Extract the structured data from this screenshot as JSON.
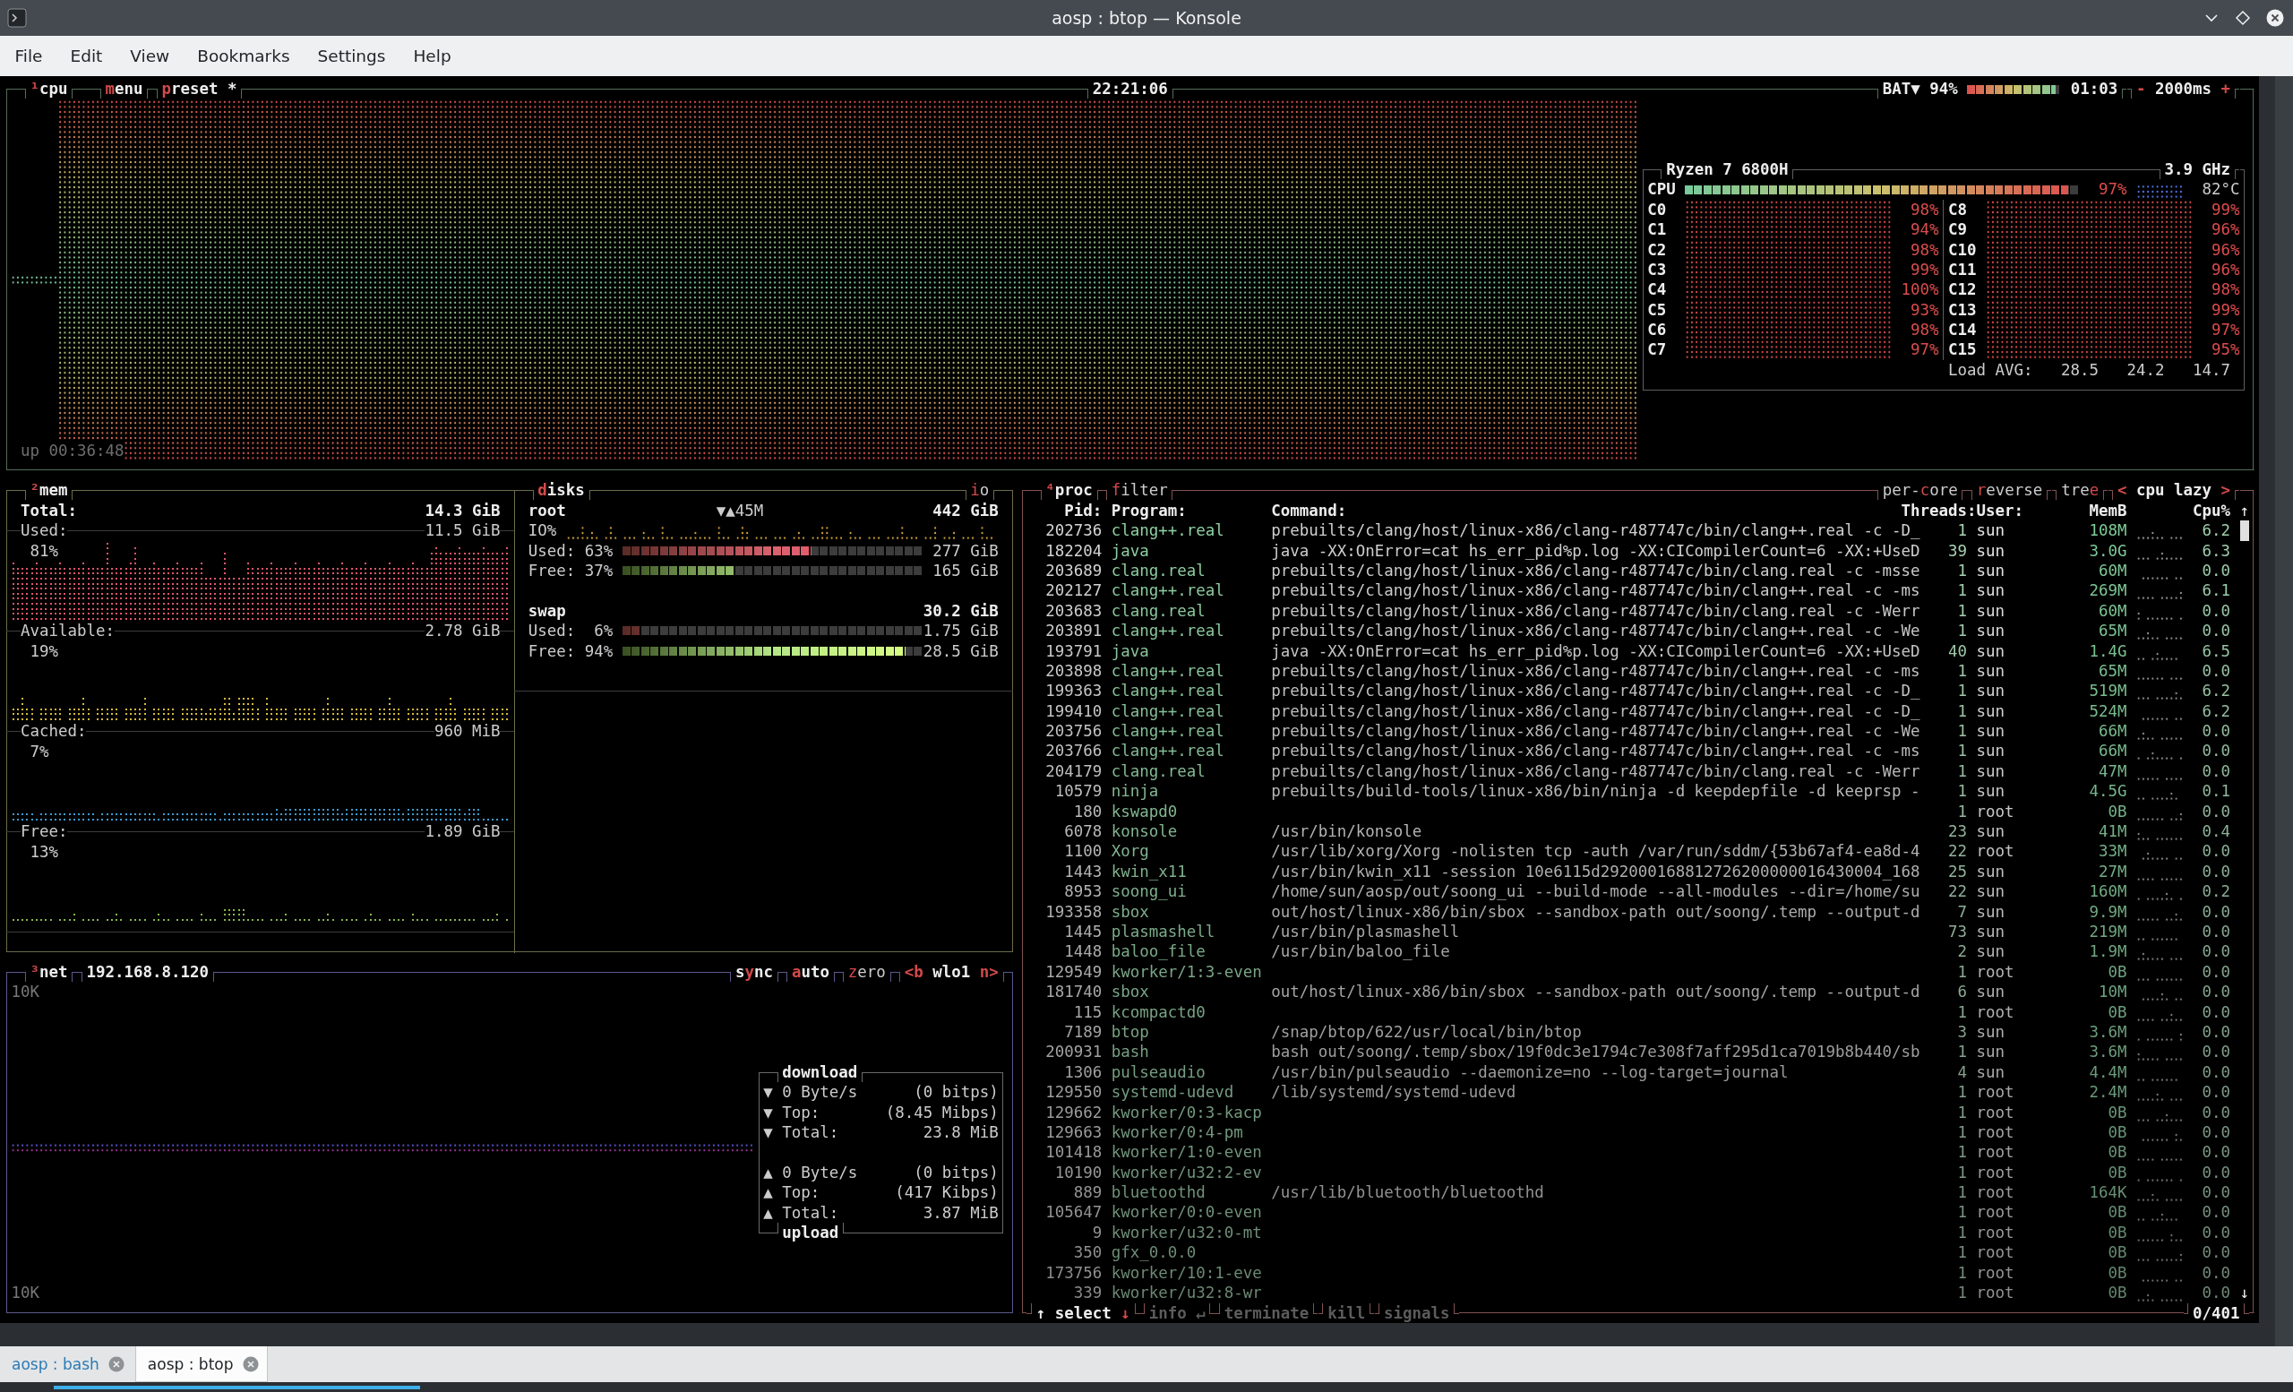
{
  "window": {
    "title": "aosp : btop — Konsole"
  },
  "menu": [
    "File",
    "Edit",
    "View",
    "Bookmarks",
    "Settings",
    "Help"
  ],
  "cpu": {
    "header": {
      "title": {
        "parts": [
          {
            "kind": "number",
            "text": "¹"
          },
          {
            "kind": "label",
            "text": "cpu"
          }
        ]
      },
      "left": [
        {
          "on": true,
          "parts": [
            {
              "kind": "key",
              "text": "m"
            },
            {
              "kind": "label",
              "text": "enu"
            }
          ]
        },
        {
          "on": true,
          "parts": [
            {
              "kind": "key",
              "text": "p"
            },
            {
              "kind": "label",
              "text": "reset *"
            }
          ]
        }
      ],
      "clock": "22:21:06",
      "battery": {
        "label": "BAT▼ 94%",
        "level": 0.94,
        "time": "01:03"
      },
      "right": [
        {
          "on": true,
          "parts": [
            {
              "kind": "key",
              "text": "-"
            },
            {
              "kind": "label",
              "text": " 2000ms "
            },
            {
              "kind": "key",
              "text": "+"
            }
          ]
        }
      ]
    },
    "uptime": "up 00:36:48",
    "info": {
      "model": "Ryzen 7 6800H",
      "frequency": "3.9 GHz",
      "total": {
        "label": "CPU",
        "level": 0.97,
        "percent": "97%",
        "temperature": "82°C"
      },
      "cores": [
        {
          "label": "C0",
          "percent": "98%"
        },
        {
          "label": "C1",
          "percent": "94%"
        },
        {
          "label": "C2",
          "percent": "98%"
        },
        {
          "label": "C3",
          "percent": "99%"
        },
        {
          "label": "C4",
          "percent": "100%"
        },
        {
          "label": "C5",
          "percent": "93%"
        },
        {
          "label": "C6",
          "percent": "98%"
        },
        {
          "label": "C7",
          "percent": "97%"
        },
        {
          "label": "C8",
          "percent": "99%"
        },
        {
          "label": "C9",
          "percent": "96%"
        },
        {
          "label": "C10",
          "percent": "96%"
        },
        {
          "label": "C11",
          "percent": "96%"
        },
        {
          "label": "C12",
          "percent": "98%"
        },
        {
          "label": "C13",
          "percent": "99%"
        },
        {
          "label": "C14",
          "percent": "97%"
        },
        {
          "label": "C15",
          "percent": "95%"
        }
      ],
      "load": {
        "label": "Load AVG:",
        "values": [
          "28.5",
          "24.2",
          "14.7"
        ]
      }
    }
  },
  "mem": {
    "header": {
      "title": {
        "parts": [
          {
            "kind": "number",
            "text": "²"
          },
          {
            "kind": "label",
            "text": "mem"
          }
        ]
      }
    },
    "total": {
      "label": "Total:",
      "value": "14.3 GiB"
    },
    "sections": [
      {
        "label": "Used:",
        "value": "11.5 GiB",
        "percent": "81%",
        "color": "#e0566b"
      },
      {
        "label": "Available:",
        "value": "2.78 GiB",
        "percent": "19%",
        "color": "#d6b83e"
      },
      {
        "label": "Cached:",
        "value": "960 MiB",
        "percent": "7%",
        "color": "#3f9bd0"
      },
      {
        "label": "Free:",
        "value": "1.89 GiB",
        "percent": "13%",
        "color": "#87b54c"
      }
    ]
  },
  "disks": {
    "header": {
      "title": {
        "parts": [
          {
            "kind": "key",
            "text": "d"
          },
          {
            "kind": "label",
            "text": "isks"
          }
        ]
      },
      "right": [
        {
          "on": false,
          "parts": [
            {
              "kind": "key",
              "text": "i"
            },
            {
              "kind": "label",
              "text": "o"
            }
          ]
        }
      ]
    },
    "items": [
      {
        "name": "root",
        "io": "▼▲45M",
        "total": "442 GiB",
        "io_label": "IO%",
        "bars": [
          {
            "kind": "used",
            "label": "Used:",
            "percent": "63%",
            "level": 0.63,
            "value": "277 GiB"
          },
          {
            "kind": "free",
            "label": "Free:",
            "percent": "37%",
            "level": 0.37,
            "value": "165 GiB"
          }
        ]
      },
      {
        "name": "swap",
        "total": "30.2 GiB",
        "bars": [
          {
            "kind": "used",
            "label": "Used:",
            "percent": "6%",
            "level": 0.06,
            "value": "1.75 GiB"
          },
          {
            "kind": "free",
            "label": "Free:",
            "percent": "94%",
            "level": 0.94,
            "value": "28.5 GiB"
          }
        ]
      }
    ]
  },
  "net": {
    "header": {
      "title": {
        "parts": [
          {
            "kind": "number",
            "text": "³"
          },
          {
            "kind": "label",
            "text": "net"
          }
        ]
      },
      "address": "192.168.8.120",
      "right": [
        {
          "on": true,
          "parts": [
            {
              "kind": "label",
              "text": "s"
            },
            {
              "kind": "key",
              "text": "y"
            },
            {
              "kind": "label",
              "text": "nc"
            }
          ]
        },
        {
          "on": true,
          "parts": [
            {
              "kind": "key",
              "text": "a"
            },
            {
              "kind": "label",
              "text": "uto"
            }
          ]
        },
        {
          "on": false,
          "parts": [
            {
              "kind": "key",
              "text": "z"
            },
            {
              "kind": "label",
              "text": "ero"
            }
          ]
        },
        {
          "on": true,
          "parts": [
            {
              "kind": "key",
              "text": "<b"
            },
            {
              "kind": "label",
              "text": " wlo1 "
            },
            {
              "kind": "key",
              "text": "n>"
            }
          ]
        }
      ]
    },
    "scale_top": "10K",
    "scale_bottom": "10K",
    "download": {
      "title": "download",
      "rows": [
        {
          "arrow": "▼",
          "label": "0 Byte/s",
          "value": "(0 bitps)"
        },
        {
          "arrow": "▼",
          "label": "Top:",
          "value": "(8.45 Mibps)"
        },
        {
          "arrow": "▼",
          "label": "Total:",
          "value": "23.8 MiB"
        }
      ]
    },
    "upload": {
      "title": "upload",
      "rows": [
        {
          "arrow": "▲",
          "label": "0 Byte/s",
          "value": "(0 bitps)"
        },
        {
          "arrow": "▲",
          "label": "Top:",
          "value": "(417 Kibps)"
        },
        {
          "arrow": "▲",
          "label": "Total:",
          "value": "3.87 MiB"
        }
      ]
    }
  },
  "proc": {
    "header": {
      "title": {
        "parts": [
          {
            "kind": "number",
            "text": "⁴"
          },
          {
            "kind": "label",
            "text": "proc"
          }
        ]
      },
      "left": [
        {
          "on": false,
          "parts": [
            {
              "kind": "key",
              "text": "f"
            },
            {
              "kind": "label",
              "text": "ilter"
            }
          ]
        }
      ],
      "right": [
        {
          "on": false,
          "parts": [
            {
              "kind": "label",
              "text": "per-"
            },
            {
              "kind": "key",
              "text": "c"
            },
            {
              "kind": "label",
              "text": "ore"
            }
          ]
        },
        {
          "on": false,
          "parts": [
            {
              "kind": "key",
              "text": "r"
            },
            {
              "kind": "label",
              "text": "everse"
            }
          ]
        },
        {
          "on": false,
          "parts": [
            {
              "kind": "label",
              "text": "tre"
            },
            {
              "kind": "key",
              "text": "e"
            }
          ]
        },
        {
          "on": true,
          "parts": [
            {
              "kind": "key",
              "text": "<"
            },
            {
              "kind": "label",
              "text": " cpu lazy "
            },
            {
              "kind": "key",
              "text": ">"
            }
          ]
        }
      ]
    },
    "columns": {
      "pid": "Pid:",
      "program": "Program:",
      "command": "Command:",
      "threads": "Threads:",
      "user": "User:",
      "mem": "MemB",
      "cpu": "Cpu%"
    },
    "scroll_up": "↑",
    "scroll_down": "↓",
    "rows": [
      {
        "pid": "202736",
        "program": "clang++.real",
        "command": "prebuilts/clang/host/linux-x86/clang-r487747c/bin/clang++.real -c -D_",
        "threads": "1",
        "user": "sun",
        "mem": "108M",
        "cpu": "6.2",
        "selected": false
      },
      {
        "pid": "182204",
        "program": "java",
        "command": "java -XX:OnError=cat hs_err_pid%p.log -XX:CICompilerCount=6 -XX:+UseD",
        "threads": "39",
        "user": "sun",
        "mem": "3.0G",
        "cpu": "6.3",
        "selected": false
      },
      {
        "pid": "203689",
        "program": "clang.real",
        "command": "prebuilts/clang/host/linux-x86/clang-r487747c/bin/clang.real -c -msse",
        "threads": "1",
        "user": "sun",
        "mem": "60M",
        "cpu": "0.0",
        "selected": false
      },
      {
        "pid": "202127",
        "program": "clang++.real",
        "command": "prebuilts/clang/host/linux-x86/clang-r487747c/bin/clang++.real -c -ms",
        "threads": "1",
        "user": "sun",
        "mem": "269M",
        "cpu": "6.1",
        "selected": false
      },
      {
        "pid": "203683",
        "program": "clang.real",
        "command": "prebuilts/clang/host/linux-x86/clang-r487747c/bin/clang.real -c -Werr",
        "threads": "1",
        "user": "sun",
        "mem": "60M",
        "cpu": "0.0",
        "selected": false
      },
      {
        "pid": "203891",
        "program": "clang++.real",
        "command": "prebuilts/clang/host/linux-x86/clang-r487747c/bin/clang++.real -c -We",
        "threads": "1",
        "user": "sun",
        "mem": "65M",
        "cpu": "0.0",
        "selected": false
      },
      {
        "pid": "193791",
        "program": "java",
        "command": "java -XX:OnError=cat hs_err_pid%p.log -XX:CICompilerCount=6 -XX:+UseD",
        "threads": "40",
        "user": "sun",
        "mem": "1.4G",
        "cpu": "6.5",
        "selected": false
      },
      {
        "pid": "203898",
        "program": "clang++.real",
        "command": "prebuilts/clang/host/linux-x86/clang-r487747c/bin/clang++.real -c -ms",
        "threads": "1",
        "user": "sun",
        "mem": "65M",
        "cpu": "0.0",
        "selected": false
      },
      {
        "pid": "199363",
        "program": "clang++.real",
        "command": "prebuilts/clang/host/linux-x86/clang-r487747c/bin/clang++.real -c -D_",
        "threads": "1",
        "user": "sun",
        "mem": "519M",
        "cpu": "6.2",
        "selected": false
      },
      {
        "pid": "199410",
        "program": "clang++.real",
        "command": "prebuilts/clang/host/linux-x86/clang-r487747c/bin/clang++.real -c -D_",
        "threads": "1",
        "user": "sun",
        "mem": "524M",
        "cpu": "6.2",
        "selected": false
      },
      {
        "pid": "203756",
        "program": "clang++.real",
        "command": "prebuilts/clang/host/linux-x86/clang-r487747c/bin/clang++.real -c -We",
        "threads": "1",
        "user": "sun",
        "mem": "66M",
        "cpu": "0.0",
        "selected": false
      },
      {
        "pid": "203766",
        "program": "clang++.real",
        "command": "prebuilts/clang/host/linux-x86/clang-r487747c/bin/clang++.real -c -ms",
        "threads": "1",
        "user": "sun",
        "mem": "66M",
        "cpu": "0.0",
        "selected": false
      },
      {
        "pid": "204179",
        "program": "clang.real",
        "command": "prebuilts/clang/host/linux-x86/clang-r487747c/bin/clang.real -c -Werr",
        "threads": "1",
        "user": "sun",
        "mem": "47M",
        "cpu": "0.0",
        "selected": false
      },
      {
        "pid": "10579",
        "program": "ninja",
        "command": "prebuilts/build-tools/linux-x86/bin/ninja -d keepdepfile -d keeprsp -",
        "threads": "1",
        "user": "sun",
        "mem": "4.5G",
        "cpu": "0.1",
        "selected": false
      },
      {
        "pid": "180",
        "program": "kswapd0",
        "threads": "1",
        "user": "root",
        "mem": "0B",
        "cpu": "0.0",
        "selected": false
      },
      {
        "pid": "6078",
        "program": "konsole",
        "command": "/usr/bin/konsole",
        "threads": "23",
        "user": "sun",
        "mem": "41M",
        "cpu": "0.4",
        "selected": false
      },
      {
        "pid": "1100",
        "program": "Xorg",
        "command": "/usr/lib/xorg/Xorg -nolisten tcp -auth /var/run/sddm/{53b67af4-ea8d-4",
        "threads": "22",
        "user": "root",
        "mem": "33M",
        "cpu": "0.0",
        "selected": false
      },
      {
        "pid": "1443",
        "program": "kwin_x11",
        "command": "/usr/bin/kwin_x11 -session 10e6115d292000168812726200000016430004_168",
        "threads": "25",
        "user": "sun",
        "mem": "27M",
        "cpu": "0.0",
        "selected": false
      },
      {
        "pid": "8953",
        "program": "soong_ui",
        "command": "/home/sun/aosp/out/soong_ui --build-mode --all-modules --dir=/home/su",
        "threads": "22",
        "user": "sun",
        "mem": "160M",
        "cpu": "0.2",
        "selected": false
      },
      {
        "pid": "193358",
        "program": "sbox",
        "command": "out/host/linux-x86/bin/sbox --sandbox-path out/soong/.temp --output-d",
        "threads": "7",
        "user": "sun",
        "mem": "9.9M",
        "cpu": "0.0",
        "selected": false
      },
      {
        "pid": "1445",
        "program": "plasmashell",
        "command": "/usr/bin/plasmashell",
        "threads": "73",
        "user": "sun",
        "mem": "219M",
        "cpu": "0.0",
        "selected": false
      },
      {
        "pid": "1448",
        "program": "baloo_file",
        "command": "/usr/bin/baloo_file",
        "threads": "2",
        "user": "sun",
        "mem": "1.9M",
        "cpu": "0.0",
        "selected": false
      },
      {
        "pid": "129549",
        "program": "kworker/1:3-even",
        "threads": "1",
        "user": "root",
        "mem": "0B",
        "cpu": "0.0",
        "selected": false
      },
      {
        "pid": "181740",
        "program": "sbox",
        "command": "out/host/linux-x86/bin/sbox --sandbox-path out/soong/.temp --output-d",
        "threads": "6",
        "user": "sun",
        "mem": "10M",
        "cpu": "0.0",
        "selected": false
      },
      {
        "pid": "115",
        "program": "kcompactd0",
        "threads": "1",
        "user": "root",
        "mem": "0B",
        "cpu": "0.0",
        "selected": false
      },
      {
        "pid": "7189",
        "program": "btop",
        "command": "/snap/btop/622/usr/local/bin/btop",
        "threads": "3",
        "user": "sun",
        "mem": "3.6M",
        "cpu": "0.0",
        "selected": false
      },
      {
        "pid": "200931",
        "program": "bash",
        "command": "bash out/soong/.temp/sbox/19f0dc3e1794c7e308f7aff295d1ca7019b8b440/sb",
        "threads": "1",
        "user": "sun",
        "mem": "3.6M",
        "cpu": "0.0",
        "selected": false
      },
      {
        "pid": "1306",
        "program": "pulseaudio",
        "command": "/usr/bin/pulseaudio --daemonize=no --log-target=journal",
        "threads": "4",
        "user": "sun",
        "mem": "4.4M",
        "cpu": "0.0",
        "selected": false
      },
      {
        "pid": "129550",
        "program": "systemd-udevd",
        "command": "/lib/systemd/systemd-udevd",
        "threads": "1",
        "user": "root",
        "mem": "2.4M",
        "cpu": "0.0",
        "selected": false
      },
      {
        "pid": "129662",
        "program": "kworker/0:3-kacp",
        "threads": "1",
        "user": "root",
        "mem": "0B",
        "cpu": "0.0",
        "selected": false
      },
      {
        "pid": "129663",
        "program": "kworker/0:4-pm",
        "threads": "1",
        "user": "root",
        "mem": "0B",
        "cpu": "0.0",
        "selected": false
      },
      {
        "pid": "101418",
        "program": "kworker/1:0-even",
        "threads": "1",
        "user": "root",
        "mem": "0B",
        "cpu": "0.0",
        "selected": false
      },
      {
        "pid": "10190",
        "program": "kworker/u32:2-ev",
        "threads": "1",
        "user": "root",
        "mem": "0B",
        "cpu": "0.0",
        "selected": false
      },
      {
        "pid": "889",
        "program": "bluetoothd",
        "command": "/usr/lib/bluetooth/bluetoothd",
        "threads": "1",
        "user": "root",
        "mem": "164K",
        "cpu": "0.0",
        "selected": false
      },
      {
        "pid": "105647",
        "program": "kworker/0:0-even",
        "threads": "1",
        "user": "root",
        "mem": "0B",
        "cpu": "0.0",
        "selected": false
      },
      {
        "pid": "9",
        "program": "kworker/u32:0-mt",
        "threads": "1",
        "user": "root",
        "mem": "0B",
        "cpu": "0.0",
        "selected": false
      },
      {
        "pid": "350",
        "program": "gfx_0.0.0",
        "threads": "1",
        "user": "root",
        "mem": "0B",
        "cpu": "0.0",
        "selected": false
      },
      {
        "pid": "173756",
        "program": "kworker/10:1-eve",
        "threads": "1",
        "user": "root",
        "mem": "0B",
        "cpu": "0.0",
        "selected": false
      },
      {
        "pid": "339",
        "program": "kworker/u32:8-wr",
        "threads": "1",
        "user": "root",
        "mem": "0B",
        "cpu": "0.0",
        "selected": false
      }
    ],
    "footer": {
      "left": [
        {
          "disabled": false,
          "parts": [
            {
              "kind": "label",
              "text": "↑ select "
            },
            {
              "kind": "key",
              "text": "↓"
            }
          ]
        },
        {
          "disabled": true,
          "parts": [
            {
              "kind": "label",
              "text": "info ↵"
            }
          ]
        },
        {
          "disabled": true,
          "parts": [
            {
              "kind": "label",
              "text": "terminate"
            }
          ]
        },
        {
          "disabled": true,
          "parts": [
            {
              "kind": "label",
              "text": "kill"
            }
          ]
        },
        {
          "disabled": true,
          "parts": [
            {
              "kind": "label",
              "text": "signals"
            }
          ]
        }
      ],
      "count": "0/401"
    }
  },
  "tabs": [
    {
      "label": "aosp : bash",
      "selected": false
    },
    {
      "label": "aosp : btop",
      "selected": true
    }
  ]
}
